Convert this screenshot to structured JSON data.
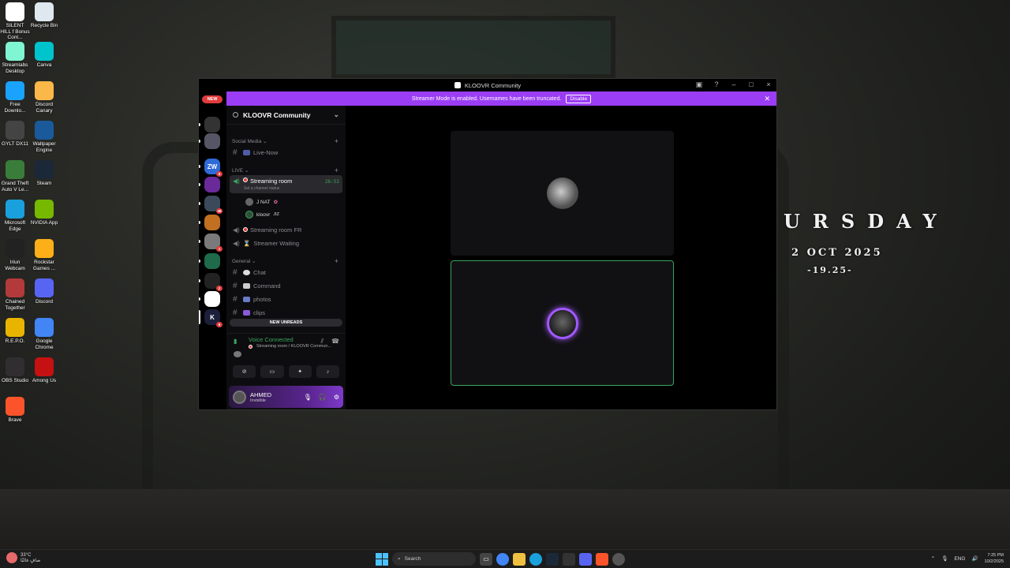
{
  "wallpaper": {
    "day": "URSDAY",
    "date": "2 OCT 2025",
    "time": "-19.25-"
  },
  "desktop_icons": [
    {
      "label": "SILENT HILL f Bonus Cont...",
      "icon": "silent-hill-icon",
      "color": "#ffffff"
    },
    {
      "label": "Recycle Bin",
      "icon": "recycle-bin-icon",
      "color": "#dfe8ef"
    },
    {
      "label": "Streamlabs Desktop",
      "icon": "streamlabs-icon",
      "color": "#80f5d2"
    },
    {
      "label": "Canva",
      "icon": "canva-icon",
      "color": "#00c4cc"
    },
    {
      "label": "Free Downlo...",
      "icon": "free-download-icon",
      "color": "#19a3ff"
    },
    {
      "label": "Discord Canary",
      "icon": "discord-canary-icon",
      "color": "#fbb848"
    },
    {
      "label": "GYLT DX11",
      "icon": "gylt-icon",
      "color": "#444444"
    },
    {
      "label": "Wallpaper Engine",
      "icon": "wallpaper-engine-icon",
      "color": "#1a5a9a"
    },
    {
      "label": "Grand Theft Auto V Le...",
      "icon": "gta-icon",
      "color": "#3a7d3a"
    },
    {
      "label": "Steam",
      "icon": "steam-icon",
      "color": "#1b2838"
    },
    {
      "label": "Microsoft Edge",
      "icon": "edge-icon",
      "color": "#1aa0dc"
    },
    {
      "label": "NVIDIA App",
      "icon": "nvidia-icon",
      "color": "#76b900"
    },
    {
      "label": "Iriun Webcam",
      "icon": "iriun-icon",
      "color": "#222222"
    },
    {
      "label": "Rockstar Games ...",
      "icon": "rockstar-icon",
      "color": "#fcaf17"
    },
    {
      "label": "Chained Together",
      "icon": "chained-together-icon",
      "color": "#b33a3a"
    },
    {
      "label": "Discord",
      "icon": "discord-icon",
      "color": "#5865f2"
    },
    {
      "label": "R.E.P.O.",
      "icon": "repo-icon",
      "color": "#e8b400"
    },
    {
      "label": "Google Chrome",
      "icon": "chrome-icon",
      "color": "#4285f4"
    },
    {
      "label": "OBS Studio",
      "icon": "obs-icon",
      "color": "#302e31"
    },
    {
      "label": "Among Us",
      "icon": "among-us-icon",
      "color": "#c51111"
    },
    {
      "label": "Brave",
      "icon": "brave-icon",
      "color": "#fb542b"
    }
  ],
  "window": {
    "title": "KLOOVR Community",
    "banner_text": "Streamer Mode is enabled. Usernames have been truncated.",
    "banner_button": "Disable",
    "new_pill": "NEW"
  },
  "servers": [
    {
      "name": "server-dm",
      "color": "#333",
      "badge": ""
    },
    {
      "name": "server-1",
      "color": "#556",
      "badge": ""
    },
    {
      "name": "server-zw",
      "color": "#2e6ad8",
      "badge": "8",
      "text": "ZW"
    },
    {
      "name": "server-3",
      "color": "#6a2a9a",
      "badge": ""
    },
    {
      "name": "server-4",
      "color": "#3a4a5a",
      "badge": "48"
    },
    {
      "name": "server-5",
      "color": "#c07020",
      "badge": ""
    },
    {
      "name": "server-6",
      "color": "#7a7a7a",
      "badge": "1"
    },
    {
      "name": "server-7",
      "color": "#1f6a4a",
      "badge": ""
    },
    {
      "name": "server-8",
      "color": "#222",
      "badge": "2"
    },
    {
      "name": "server-9",
      "color": "#ffffff",
      "badge": ""
    },
    {
      "name": "server-kloovr",
      "color": "#1b1f3a",
      "badge": "6",
      "text": "K"
    }
  ],
  "channels": {
    "server_name": "KLOOVR Community",
    "categories": {
      "social": "Social Media",
      "live": "LIVE",
      "general": "General"
    },
    "live_now": "Live-Now",
    "streaming_room": "Streaming room",
    "channel_status": "Set a channel status",
    "timer": "26:52",
    "voice_users": [
      {
        "name": "J NAT",
        "tag": ""
      },
      {
        "name": "kloovr",
        "tag": "JIZ"
      }
    ],
    "streaming_room_fr": "Streaming room FR",
    "streamer_waiting": "Streamer Waiting",
    "chat": "Chat",
    "command": "Command",
    "photos": "photos",
    "clips": "clips",
    "new_unreads": "NEW UNREADS"
  },
  "voice": {
    "status": "Voice Connected",
    "location": "Streaming room / KLOOVR Commun..."
  },
  "user": {
    "name": "AHMED",
    "status": "Invisible"
  },
  "taskbar": {
    "temp": "33°C",
    "weather": "صافٍ غالبًا",
    "search": "Search",
    "lang": "ENG",
    "time": "7:25 PM",
    "date": "10/2/2025"
  }
}
